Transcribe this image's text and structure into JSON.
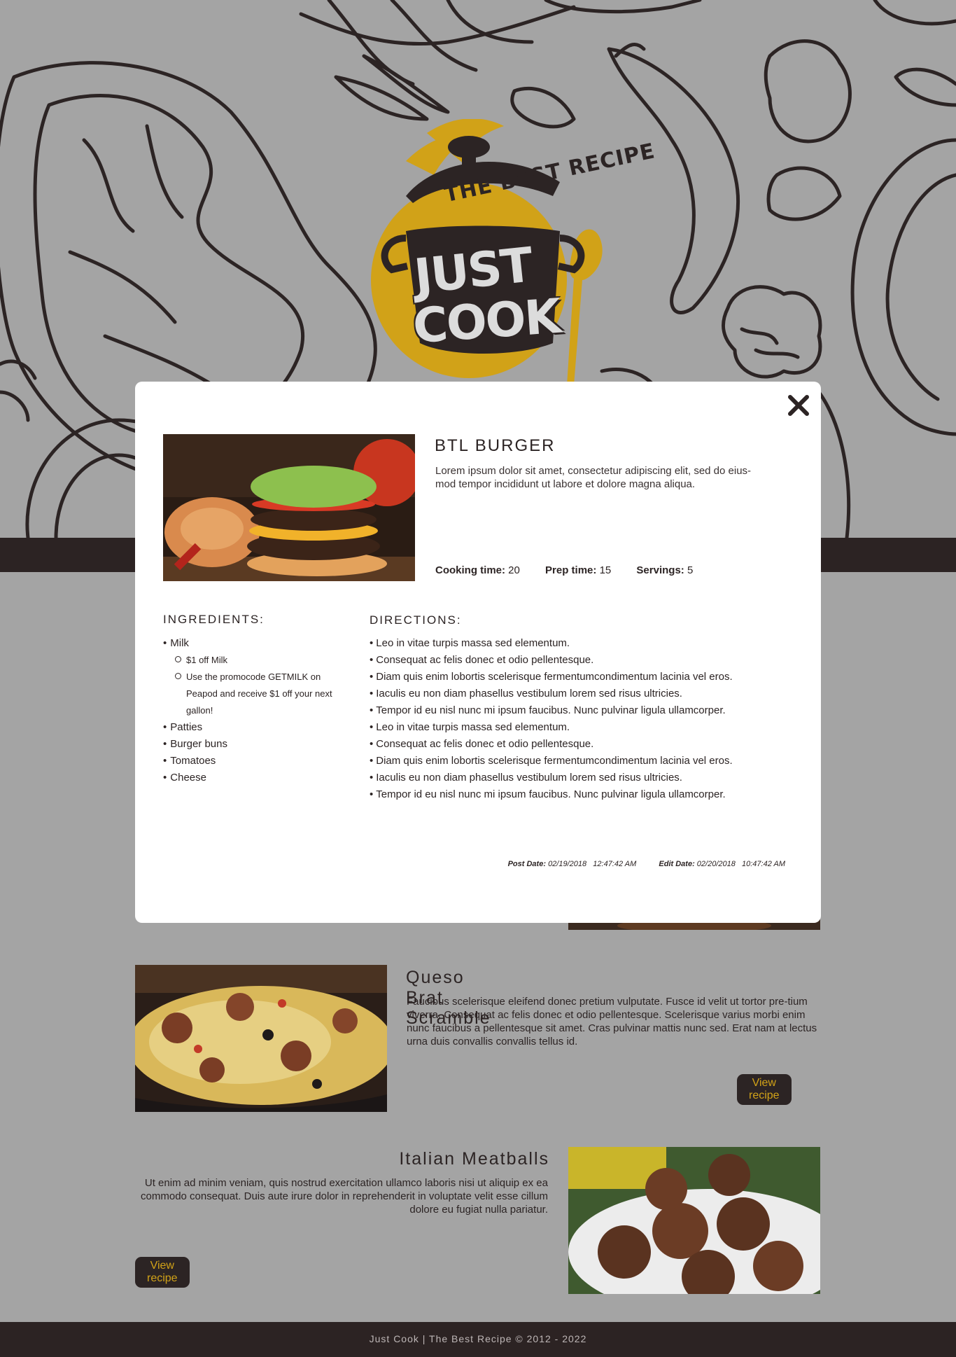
{
  "brand": {
    "tagline": "THE BEST RECIPE",
    "word1": "JUST",
    "word2": "COOK",
    "colors": {
      "dark": "#2c2323",
      "gold": "#d1a218",
      "background": "#a4a4a4"
    }
  },
  "modal": {
    "close_icon": "close-icon",
    "title": "BTL BURGER",
    "description": "Lorem ipsum dolor sit amet, consectetur adipiscing elit, sed do eius-mod tempor incididunt ut labore et dolore magna aliqua.",
    "meta": {
      "cooking_label": "Cooking time:",
      "cooking_value": "20",
      "prep_label": "Prep time:",
      "prep_value": "15",
      "servings_label": "Servings:",
      "servings_value": "5"
    },
    "ingredients_title": "INGREDIENTS:",
    "ingredients": {
      "milk": "Milk",
      "milk_sub1": "$1 off Milk",
      "milk_sub2": "Use the promocode GETMILK on Peapod and receive $1 off your next gallon!",
      "patties": "Patties",
      "buns": "Burger buns",
      "tomatoes": "Tomatoes",
      "cheese": "Cheese"
    },
    "directions_title": "DIRECTIONS:",
    "directions": [
      "Leo in vitae turpis massa sed elementum.",
      "Consequat ac felis donec et odio pellentesque.",
      "Diam quis enim lobortis scelerisque fermentumcondimentum lacinia vel eros.",
      "Iaculis eu non diam phasellus vestibulum lorem sed risus ultricies.",
      "Tempor id eu nisl nunc mi ipsum faucibus. Nunc pulvinar ligula ullamcorper.",
      "Leo in vitae turpis massa sed elementum.",
      "Consequat ac felis donec et odio pellentesque.",
      "Diam quis enim lobortis scelerisque fermentumcondimentum lacinia vel eros.",
      "Iaculis eu non diam phasellus vestibulum lorem sed risus ultricies.",
      "Tempor id eu nisl nunc mi ipsum faucibus. Nunc pulvinar ligula ullamcorper."
    ],
    "post_label": "Post Date:",
    "post_value": "02/19/2018   12:47:42 AM",
    "edit_label": "Edit Date:",
    "edit_value": "02/20/2018   10:47:42 AM"
  },
  "recipes": [
    {
      "title": "Queso Brat Scramble",
      "text": "Faucibus scelerisque eleifend donec pretium vulputate. Fusce id velit ut tortor pre-tium viverra. Consequat ac felis donec et odio pellentesque. Scelerisque varius morbi enim nunc faucibus a pellentesque sit amet. Cras pulvinar mattis nunc sed. Erat nam at lectus urna duis convallis convallis tellus id.",
      "button": "View recipe"
    },
    {
      "title": "Italian Meatballs",
      "text": "Ut enim ad minim veniam, quis nostrud exercitation ullamco laboris nisi ut aliquip ex ea commodo consequat. Duis aute irure dolor in reprehenderit in voluptate velit esse cillum dolore eu fugiat nulla pariatur.",
      "button": "View recipe"
    }
  ],
  "footer": {
    "text": "Just Cook | The Best Recipe © 2012 - 2022"
  }
}
